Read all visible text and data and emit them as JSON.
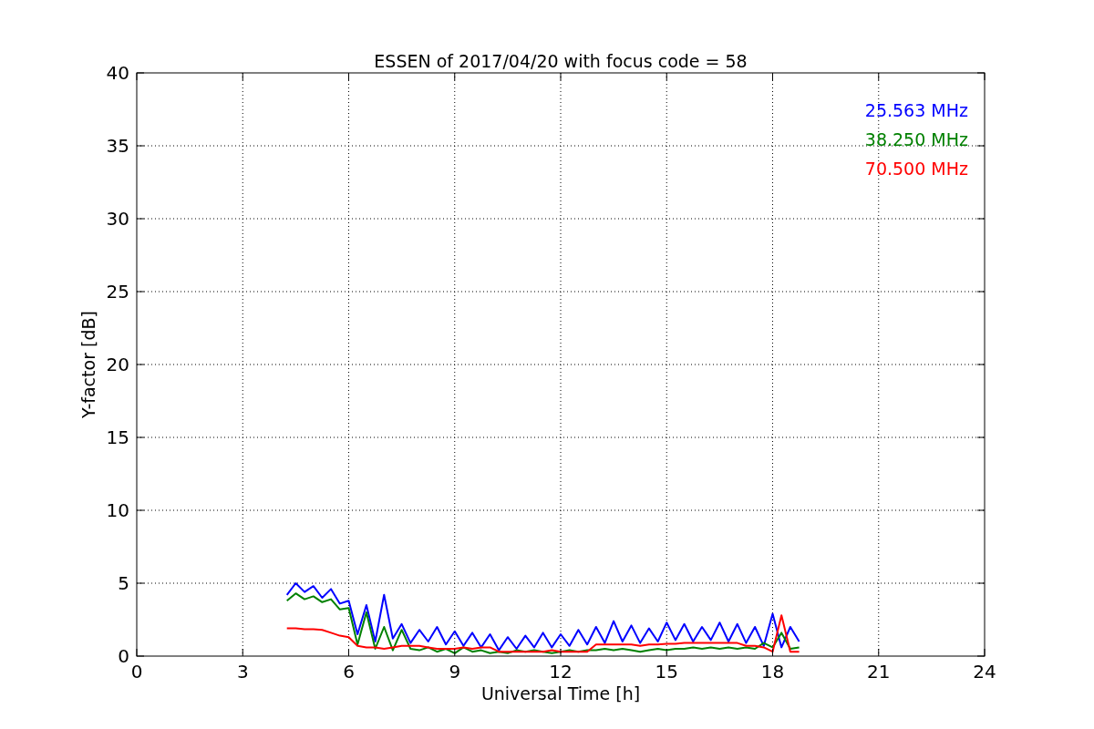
{
  "chart_data": {
    "type": "line",
    "title": "ESSEN of 2017/04/20 with focus code = 58",
    "xlabel": "Universal Time [h]",
    "ylabel": "Y-factor [dB]",
    "x": [
      4.25,
      4.5,
      4.75,
      5.0,
      5.25,
      5.5,
      5.75,
      6.0,
      6.25,
      6.5,
      6.75,
      7.0,
      7.25,
      7.5,
      7.75,
      8.0,
      8.25,
      8.5,
      8.75,
      9.0,
      9.25,
      9.5,
      9.75,
      10.0,
      10.25,
      10.5,
      10.75,
      11.0,
      11.25,
      11.5,
      11.75,
      12.0,
      12.25,
      12.5,
      12.75,
      13.0,
      13.25,
      13.5,
      13.75,
      14.0,
      14.25,
      14.5,
      14.75,
      15.0,
      15.25,
      15.5,
      15.75,
      16.0,
      16.25,
      16.5,
      16.75,
      17.0,
      17.25,
      17.5,
      17.75,
      18.0,
      18.25,
      18.5,
      18.75
    ],
    "series": [
      {
        "name": "25.563 MHz",
        "color": "#0000ff",
        "values": [
          4.2,
          5.0,
          4.4,
          4.8,
          4.0,
          4.6,
          3.6,
          3.8,
          1.5,
          3.5,
          1.0,
          4.2,
          1.2,
          2.2,
          0.9,
          1.8,
          1.0,
          2.0,
          0.8,
          1.7,
          0.7,
          1.6,
          0.6,
          1.5,
          0.4,
          1.3,
          0.5,
          1.4,
          0.6,
          1.6,
          0.6,
          1.5,
          0.7,
          1.8,
          0.8,
          2.0,
          0.9,
          2.4,
          1.0,
          2.1,
          0.9,
          1.9,
          1.0,
          2.3,
          1.1,
          2.2,
          1.0,
          2.0,
          1.1,
          2.3,
          1.0,
          2.2,
          0.9,
          2.0,
          0.7,
          2.9,
          0.6,
          2.0,
          1.0
        ]
      },
      {
        "name": "38.250 MHz",
        "color": "#008000",
        "values": [
          3.8,
          4.3,
          3.9,
          4.1,
          3.7,
          3.9,
          3.2,
          3.3,
          0.8,
          3.0,
          0.5,
          2.0,
          0.4,
          1.8,
          0.5,
          0.4,
          0.6,
          0.3,
          0.5,
          0.2,
          0.6,
          0.3,
          0.4,
          0.2,
          0.3,
          0.2,
          0.4,
          0.3,
          0.4,
          0.3,
          0.2,
          0.3,
          0.4,
          0.3,
          0.4,
          0.4,
          0.5,
          0.4,
          0.5,
          0.4,
          0.3,
          0.4,
          0.5,
          0.4,
          0.5,
          0.5,
          0.6,
          0.5,
          0.6,
          0.5,
          0.6,
          0.5,
          0.6,
          0.5,
          0.9,
          0.6,
          1.6,
          0.5,
          0.6
        ]
      },
      {
        "name": "70.500 MHz",
        "color": "#ff0000",
        "values": [
          1.9,
          1.9,
          1.85,
          1.85,
          1.8,
          1.6,
          1.4,
          1.3,
          0.7,
          0.6,
          0.6,
          0.5,
          0.6,
          0.7,
          0.7,
          0.7,
          0.6,
          0.5,
          0.5,
          0.5,
          0.6,
          0.5,
          0.6,
          0.6,
          0.3,
          0.3,
          0.3,
          0.3,
          0.3,
          0.3,
          0.4,
          0.3,
          0.3,
          0.3,
          0.3,
          0.8,
          0.8,
          0.8,
          0.8,
          0.8,
          0.7,
          0.8,
          0.8,
          0.85,
          0.85,
          0.9,
          0.9,
          0.9,
          0.9,
          0.9,
          0.9,
          0.9,
          0.7,
          0.7,
          0.6,
          0.3,
          2.8,
          0.3,
          0.3
        ]
      }
    ],
    "grid": true,
    "xlim": [
      0,
      24
    ],
    "ylim": [
      0,
      40
    ],
    "xticks": [
      0,
      3,
      6,
      9,
      12,
      15,
      18,
      21,
      24
    ],
    "yticks": [
      0,
      5,
      10,
      15,
      20,
      25,
      30,
      35,
      40
    ]
  }
}
